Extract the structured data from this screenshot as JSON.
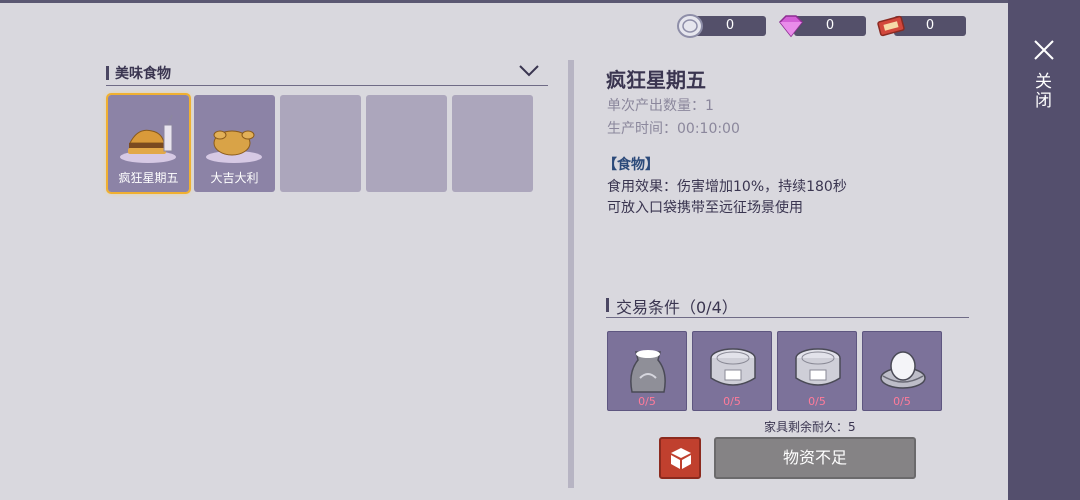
{
  "currency": [
    {
      "icon": "silver-coin-icon",
      "value": "0"
    },
    {
      "icon": "diamond-icon",
      "value": "0"
    },
    {
      "icon": "ticket-icon",
      "value": "0"
    }
  ],
  "category": {
    "title": "美味食物"
  },
  "slots": [
    {
      "label": "疯狂星期五",
      "icon": "burger-meal-icon"
    },
    {
      "label": "大吉大利",
      "icon": "roast-chicken-icon"
    },
    {
      "label": ""
    },
    {
      "label": ""
    },
    {
      "label": ""
    }
  ],
  "detail": {
    "name": "疯狂星期五",
    "output_qty": "单次产出数量：1",
    "prod_time": "生产时间：00:10:00",
    "category": "【食物】",
    "effect": "食用效果：伤害增加10%，持续180秒",
    "usage": "可放入口袋携带至远征场景使用"
  },
  "trade": {
    "title": "交易条件（0/4）",
    "requirements": [
      {
        "icon": "flour-sack-icon",
        "count": "0/5"
      },
      {
        "icon": "canned-food-icon",
        "count": "0/5"
      },
      {
        "icon": "canned-food-icon",
        "count": "0/5"
      },
      {
        "icon": "egg-nest-icon",
        "count": "0/5"
      }
    ],
    "durability": "家具剩余耐久：5",
    "status_button": "物资不足"
  },
  "close": {
    "label": "关闭"
  },
  "colors": {
    "accent_selected": "#f0b030",
    "sidebar": "#544f6d",
    "warning_count": "#ff7b9a",
    "box_button": "#c0402e"
  }
}
